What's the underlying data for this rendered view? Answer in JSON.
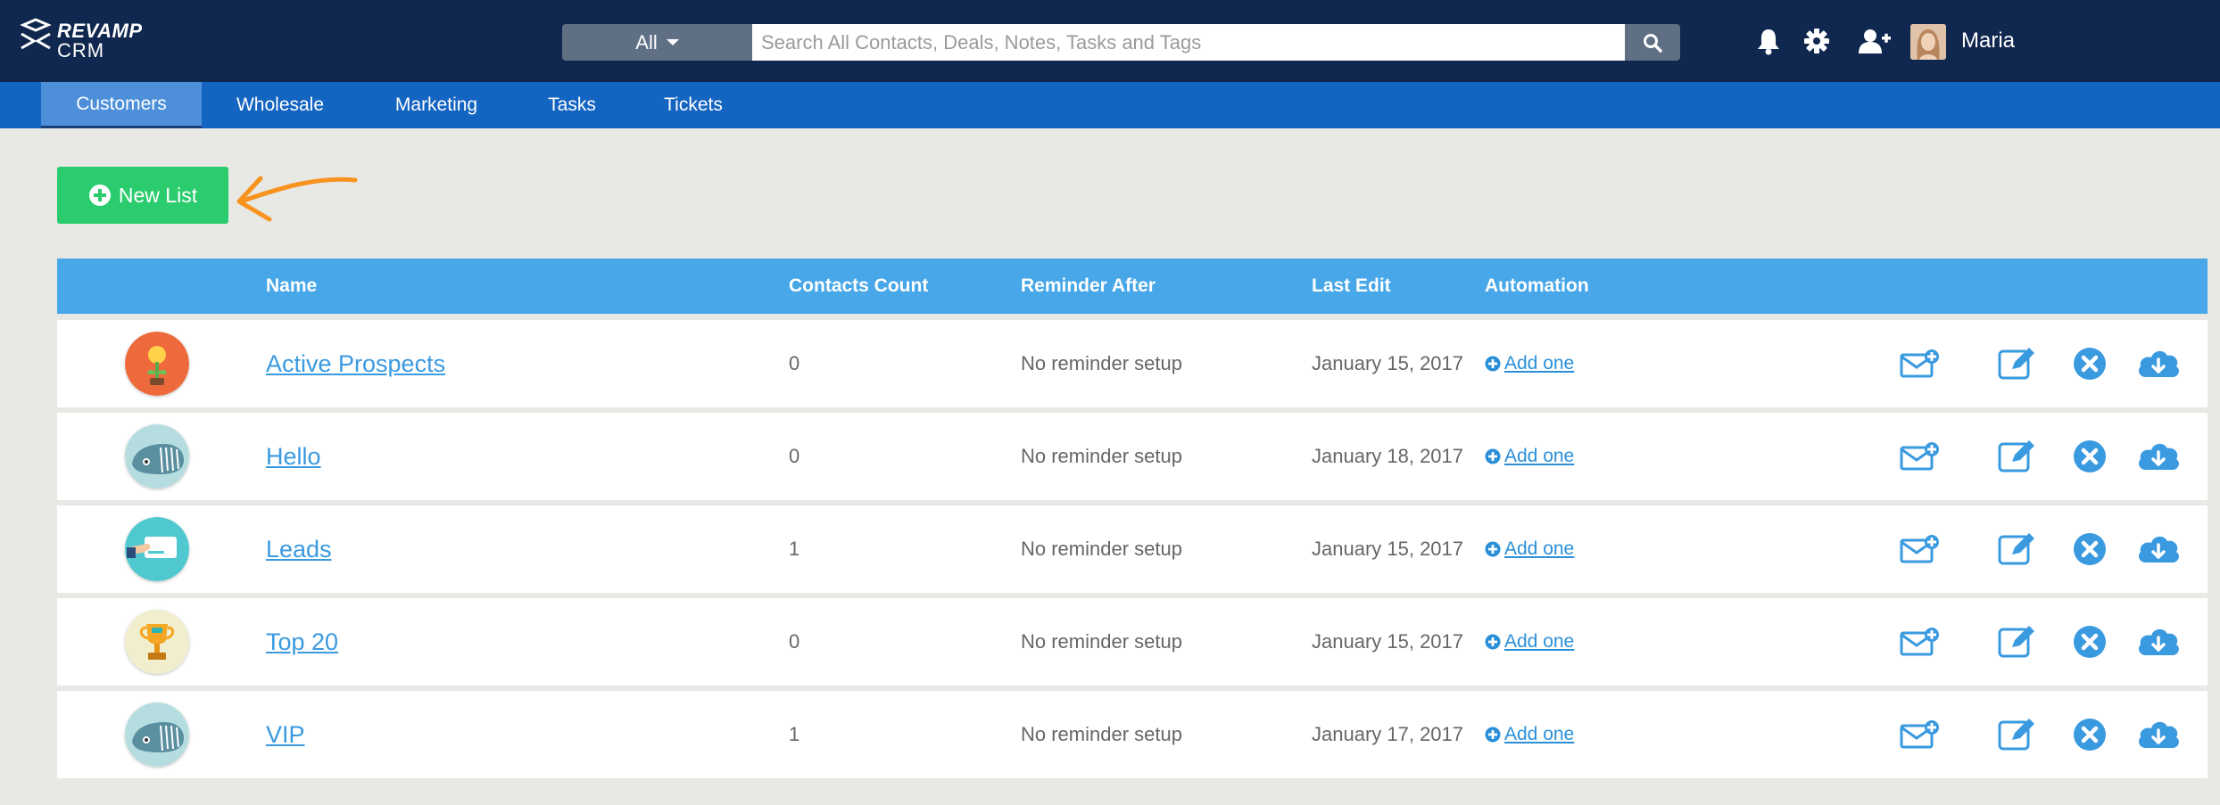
{
  "app": {
    "logo_line1": "REVAMP",
    "logo_line2": "CRM",
    "user_name": "Maria"
  },
  "search": {
    "scope_value": "All",
    "placeholder": "Search All Contacts, Deals, Notes, Tasks and Tags"
  },
  "header_icons": [
    "bell-icon",
    "gear-icon",
    "add-user-icon"
  ],
  "nav": {
    "tabs": [
      {
        "label": "Customers",
        "active": true
      },
      {
        "label": "Wholesale",
        "active": false
      },
      {
        "label": "Marketing",
        "active": false
      },
      {
        "label": "Tasks",
        "active": false
      },
      {
        "label": "Tickets",
        "active": false
      }
    ]
  },
  "toolbar": {
    "new_list_label": "New List"
  },
  "table": {
    "columns": [
      "Name",
      "Contacts Count",
      "Reminder After",
      "Last Edit",
      "Automation"
    ],
    "rows": [
      {
        "icon": "lightbulb-plant-icon",
        "name": "Active Prospects",
        "count": "0",
        "reminder": "No reminder setup",
        "last_edit": "January 15, 2017",
        "automation": "Add one"
      },
      {
        "icon": "whale-icon",
        "name": "Hello",
        "count": "0",
        "reminder": "No reminder setup",
        "last_edit": "January 18, 2017",
        "automation": "Add one"
      },
      {
        "icon": "card-hand-icon",
        "name": "Leads",
        "count": "1",
        "reminder": "No reminder setup",
        "last_edit": "January 15, 2017",
        "automation": "Add one"
      },
      {
        "icon": "trophy-icon",
        "name": "Top 20",
        "count": "0",
        "reminder": "No reminder setup",
        "last_edit": "January 15, 2017",
        "automation": "Add one"
      },
      {
        "icon": "whale-icon",
        "name": "VIP",
        "count": "1",
        "reminder": "No reminder setup",
        "last_edit": "January 17, 2017",
        "automation": "Add one"
      }
    ],
    "row_actions": [
      "email-add-icon",
      "edit-icon",
      "delete-icon",
      "download-icon"
    ]
  },
  "colors": {
    "topbar": "#10284f",
    "nav": "#1464c2",
    "nav_active": "#4d8fd9",
    "new_list_button": "#2bcc6e",
    "table_header": "#48a7e8",
    "link": "#3a9ae0",
    "arrow_annotation": "#f7931e"
  }
}
